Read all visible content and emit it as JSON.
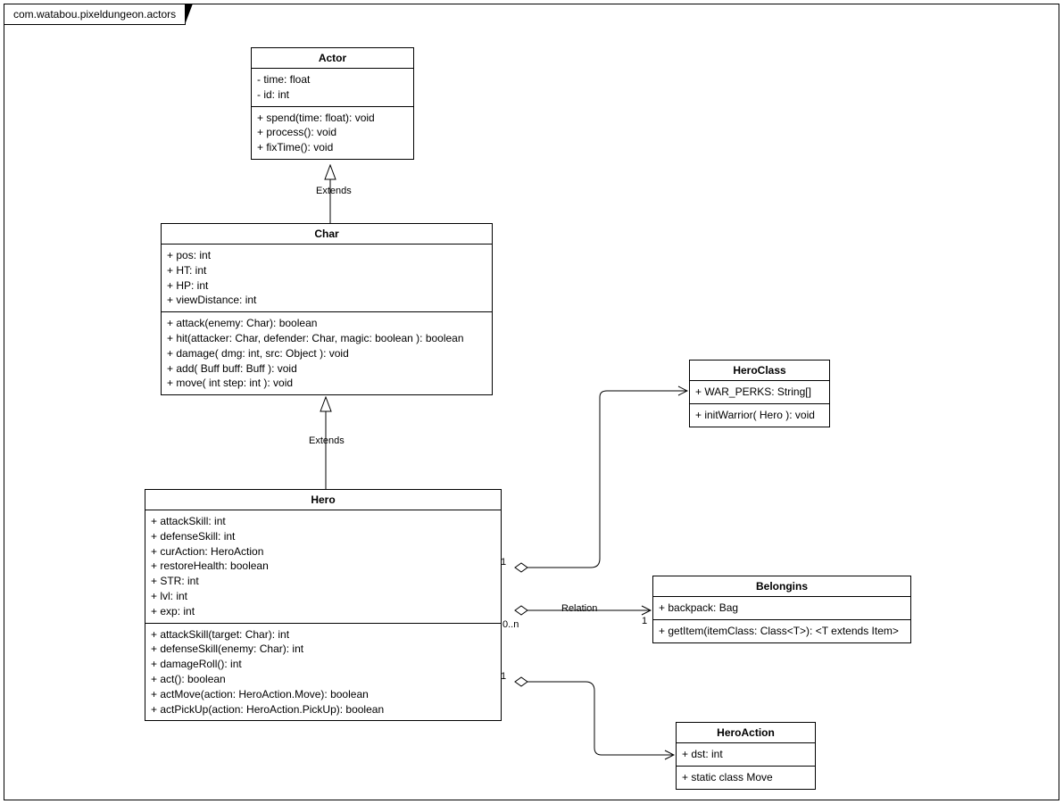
{
  "package": {
    "name": "com.watabou.pixeldungeon.actors"
  },
  "classes": {
    "actor": {
      "name": "Actor",
      "attrs": [
        "- time: float",
        "- id: int"
      ],
      "ops": [
        "+ spend(time: float): void",
        "+ process(): void",
        "+ fixTime(): void"
      ]
    },
    "char": {
      "name": "Char",
      "attrs": [
        "+ pos: int",
        "+ HT: int",
        "+ HP: int",
        "+ viewDistance: int"
      ],
      "ops": [
        "+ attack(enemy: Char): boolean",
        "+ hit(attacker: Char, defender: Char, magic: boolean ): boolean",
        "+ damage( dmg: int, src: Object ): void",
        "+ add( Buff buff: Buff ): void",
        "+ move( int step: int ): void"
      ]
    },
    "hero": {
      "name": "Hero",
      "attrs": [
        "+ attackSkill: int",
        "+ defenseSkill: int",
        "+ curAction: HeroAction",
        "+ restoreHealth: boolean",
        "+ STR: int",
        "+ lvl: int",
        "+ exp: int"
      ],
      "ops": [
        "+ attackSkill(target: Char): int",
        "+ defenseSkill(enemy: Char): int",
        "+ damageRoll(): int",
        "+ act(): boolean",
        "+ actMove(action: HeroAction.Move): boolean",
        "+ actPickUp(action: HeroAction.PickUp): boolean"
      ]
    },
    "heroclass": {
      "name": "HeroClass",
      "attrs": [
        "+ WAR_PERKS: String[]"
      ],
      "ops": [
        "+ initWarrior( Hero ): void"
      ]
    },
    "belongings": {
      "name": "Belongins",
      "attrs": [
        "+ backpack: Bag"
      ],
      "ops": [
        "+ getItem(itemClass: Class<T>): <T extends Item>"
      ]
    },
    "heroaction": {
      "name": "HeroAction",
      "attrs": [
        "+ dst: int"
      ],
      "ops": [
        "+ static class Move"
      ]
    }
  },
  "relations": {
    "extends1": "Extends",
    "extends2": "Extends",
    "relation": "Relation",
    "mult_1a": "1",
    "mult_1b": "1",
    "mult_1c": "1",
    "mult_0n": "0..n"
  }
}
